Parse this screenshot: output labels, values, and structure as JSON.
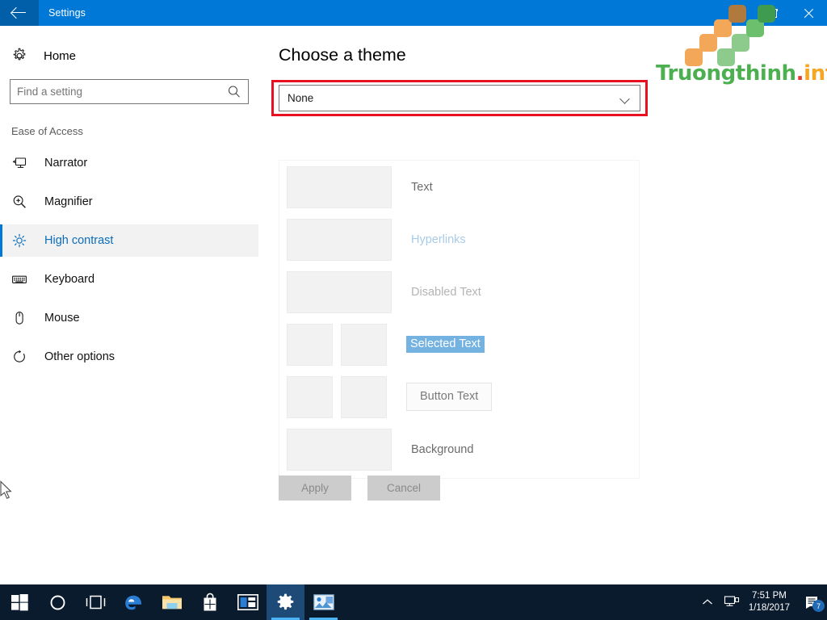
{
  "window": {
    "title": "Settings",
    "back_icon": "back-arrow-icon",
    "controls": {
      "minimize": "minimize-icon",
      "maximize": "restore-icon",
      "close": "close-icon"
    }
  },
  "sidebar": {
    "home_label": "Home",
    "home_icon": "gear-icon",
    "search": {
      "placeholder": "Find a setting",
      "value": "",
      "icon": "search-icon"
    },
    "section_label": "Ease of Access",
    "items": [
      {
        "label": "Narrator",
        "icon": "narrator-icon",
        "selected": false
      },
      {
        "label": "Magnifier",
        "icon": "magnifier-icon",
        "selected": false
      },
      {
        "label": "High contrast",
        "icon": "brightness-icon",
        "selected": true
      },
      {
        "label": "Keyboard",
        "icon": "keyboard-icon",
        "selected": false
      },
      {
        "label": "Mouse",
        "icon": "mouse-icon",
        "selected": false
      },
      {
        "label": "Other options",
        "icon": "other-options-icon",
        "selected": false
      }
    ]
  },
  "main": {
    "title": "Choose a theme",
    "theme_select": {
      "value": "None",
      "chevron_icon": "chevron-down-icon",
      "highlighted": true,
      "highlight_color": "#e81123"
    },
    "preview_rows": [
      {
        "label": "Text",
        "style": "text",
        "swatches": 1
      },
      {
        "label": "Hyperlinks",
        "style": "link",
        "swatches": 1
      },
      {
        "label": "Disabled Text",
        "style": "disabled",
        "swatches": 1
      },
      {
        "label": "Selected Text",
        "style": "selected",
        "swatches": 2
      },
      {
        "label": "Button Text",
        "style": "button",
        "swatches": 2
      },
      {
        "label": "Background",
        "style": "background",
        "swatches": 1
      }
    ],
    "apply_label": "Apply",
    "cancel_label": "Cancel"
  },
  "watermark": {
    "text_main": "Truongthinh",
    "text_dot": ".",
    "text_tld": "info",
    "colors": {
      "main": "#4caf50",
      "dot": "#e53935",
      "tld": "#f5a623"
    }
  },
  "taskbar": {
    "items": [
      {
        "name": "start-button",
        "icon": "windows-logo-icon",
        "state": "idle"
      },
      {
        "name": "cortana-button",
        "icon": "circle-icon",
        "state": "idle"
      },
      {
        "name": "task-view-button",
        "icon": "task-view-icon",
        "state": "idle"
      },
      {
        "name": "edge-button",
        "icon": "edge-icon",
        "state": "idle"
      },
      {
        "name": "file-explorer",
        "icon": "folder-icon",
        "state": "idle"
      },
      {
        "name": "store-button",
        "icon": "store-bag-icon",
        "state": "idle"
      },
      {
        "name": "app-window",
        "icon": "window-icon",
        "state": "idle"
      },
      {
        "name": "settings-button",
        "icon": "gear-icon",
        "state": "active"
      },
      {
        "name": "photo-app-button",
        "icon": "picture-icon",
        "state": "running"
      }
    ],
    "tray": {
      "overflow_icon": "chevron-up-icon",
      "network_icon": "network-icon",
      "time": "7:51 PM",
      "date": "1/18/2017",
      "notification_icon": "action-center-icon",
      "notification_count": "7"
    }
  }
}
